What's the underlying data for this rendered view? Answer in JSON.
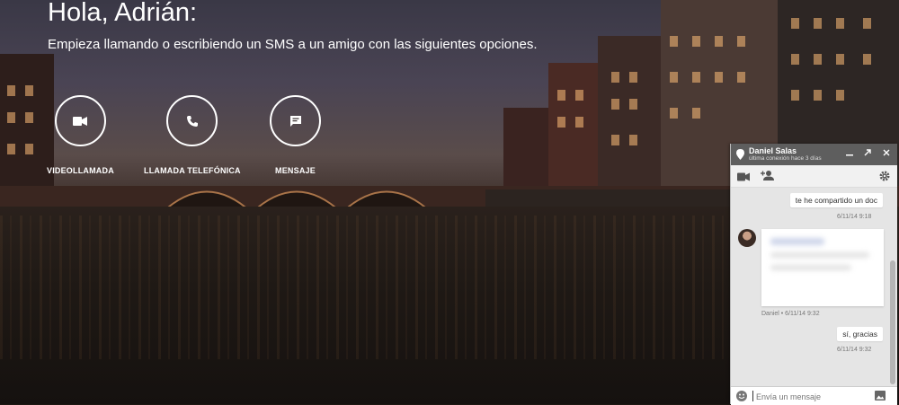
{
  "hero": {
    "greeting": "Hola, Adrián:",
    "subtitle": "Empieza llamando o escribiendo un SMS a un amigo con las siguientes opciones."
  },
  "actions": [
    {
      "label": "VIDEOLLAMADA",
      "icon": "video-camera-icon"
    },
    {
      "label": "LLAMADA TELEFÓNICA",
      "icon": "phone-icon"
    },
    {
      "label": "MENSAJE",
      "icon": "message-icon"
    }
  ],
  "chat": {
    "contact_name": "Daniel Salas",
    "status": "última conexión hace 3 días",
    "header_buttons": [
      "minimize-icon",
      "popout-icon",
      "close-icon"
    ],
    "toolbar_icons": [
      "video-camera-icon",
      "add-person-icon",
      "gear-icon"
    ],
    "messages": [
      {
        "direction": "out",
        "text": "te he compartido un doc",
        "time": "6/11/14 9:18"
      },
      {
        "direction": "in",
        "type": "attachment",
        "meta": "Daniel • 6/11/14 9:32"
      },
      {
        "direction": "out",
        "text": "sí, gracias",
        "time": "6/11/14 9:32"
      }
    ],
    "composer_placeholder": "Envía un mensaje"
  },
  "colors": {
    "chat_header": "#5e5e5e",
    "chat_body": "#e5e5e5",
    "hero_text": "#ffffff"
  }
}
